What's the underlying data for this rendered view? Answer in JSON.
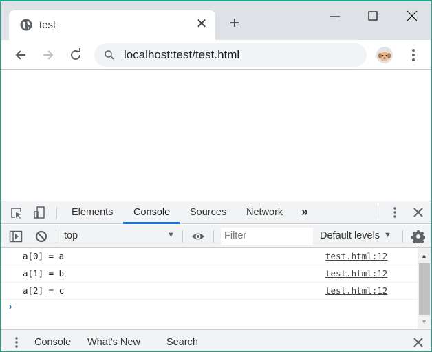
{
  "browser": {
    "tab": {
      "title": "test",
      "icon": "globe-icon"
    },
    "new_tab_label": "+",
    "window_controls": [
      "minimize-icon",
      "maximize-icon",
      "close-icon"
    ],
    "address_bar": {
      "url": "localhost:test/test.html"
    },
    "nav_icons": [
      "back-arrow-icon",
      "forward-arrow-icon",
      "reload-icon"
    ]
  },
  "devtools": {
    "tabs": [
      "Elements",
      "Console",
      "Sources",
      "Network"
    ],
    "active_tab": "Console",
    "more_tabs_label": "»",
    "context": "top",
    "filter_placeholder": "Filter",
    "levels_label": "Default levels",
    "messages": [
      {
        "text": "a[0] = a",
        "source": "test.html:12"
      },
      {
        "text": "a[1] = b",
        "source": "test.html:12"
      },
      {
        "text": "a[2] = c",
        "source": "test.html:12"
      }
    ],
    "prompt": "›",
    "drawer": {
      "tabs": [
        "Console",
        "What's New",
        "Search"
      ],
      "active_tab": "Console"
    }
  },
  "colors": {
    "accent": "#1a73e8",
    "window_border": "#1fa58a",
    "titlebar": "#dee1e6",
    "devtools_bar": "#f1f3f4"
  }
}
